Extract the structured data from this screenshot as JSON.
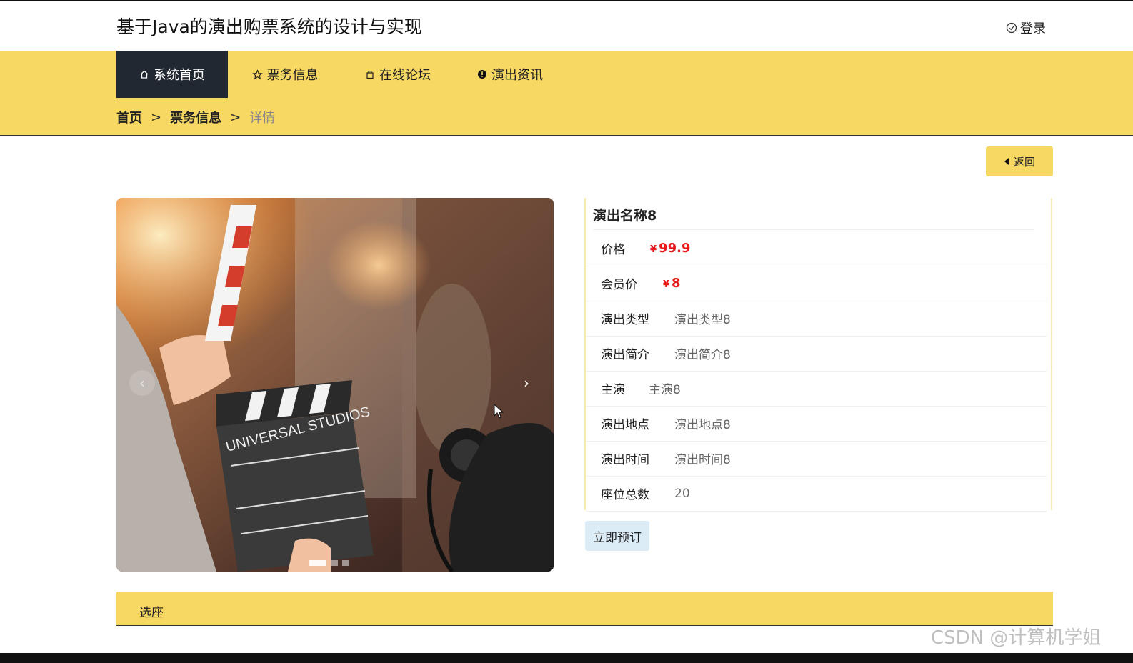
{
  "header": {
    "title": "基于Java的演出购票系统的设计与实现",
    "login_label": "登录"
  },
  "nav": {
    "items": [
      {
        "label": "系统首页",
        "icon": "home-icon",
        "active": true
      },
      {
        "label": "票务信息",
        "icon": "star-icon",
        "active": false
      },
      {
        "label": "在线论坛",
        "icon": "bag-icon",
        "active": false
      },
      {
        "label": "演出资讯",
        "icon": "info-icon",
        "active": false
      }
    ]
  },
  "breadcrumb": {
    "home": "首页",
    "sep": ">",
    "section": "票务信息",
    "current": "详情"
  },
  "back_button": {
    "label": "返回",
    "icon": "caret-left-icon"
  },
  "carousel": {
    "prev_glyph": "‹",
    "next_glyph": "›",
    "slide_count": 3,
    "active_index": 0
  },
  "detail": {
    "name": "演出名称8",
    "currency": "¥",
    "price": "99.9",
    "member_price": "8",
    "rows": [
      {
        "label": "价格"
      },
      {
        "label": "会员价"
      },
      {
        "label": "演出类型",
        "value": "演出类型8"
      },
      {
        "label": "演出简介",
        "value": "演出简介8"
      },
      {
        "label": "主演",
        "value": "主演8"
      },
      {
        "label": "演出地点",
        "value": "演出地点8"
      },
      {
        "label": "演出时间",
        "value": "演出时间8"
      },
      {
        "label": "座位总数",
        "value": "20"
      }
    ]
  },
  "book_button": {
    "label": "立即预订"
  },
  "seat_section": {
    "label": "选座"
  },
  "watermark": "CSDN @计算机学姐",
  "colors": {
    "accent": "#f6d862",
    "nav_active": "#222831",
    "price": "#e81c1c",
    "book_button": "#dbecf7"
  }
}
